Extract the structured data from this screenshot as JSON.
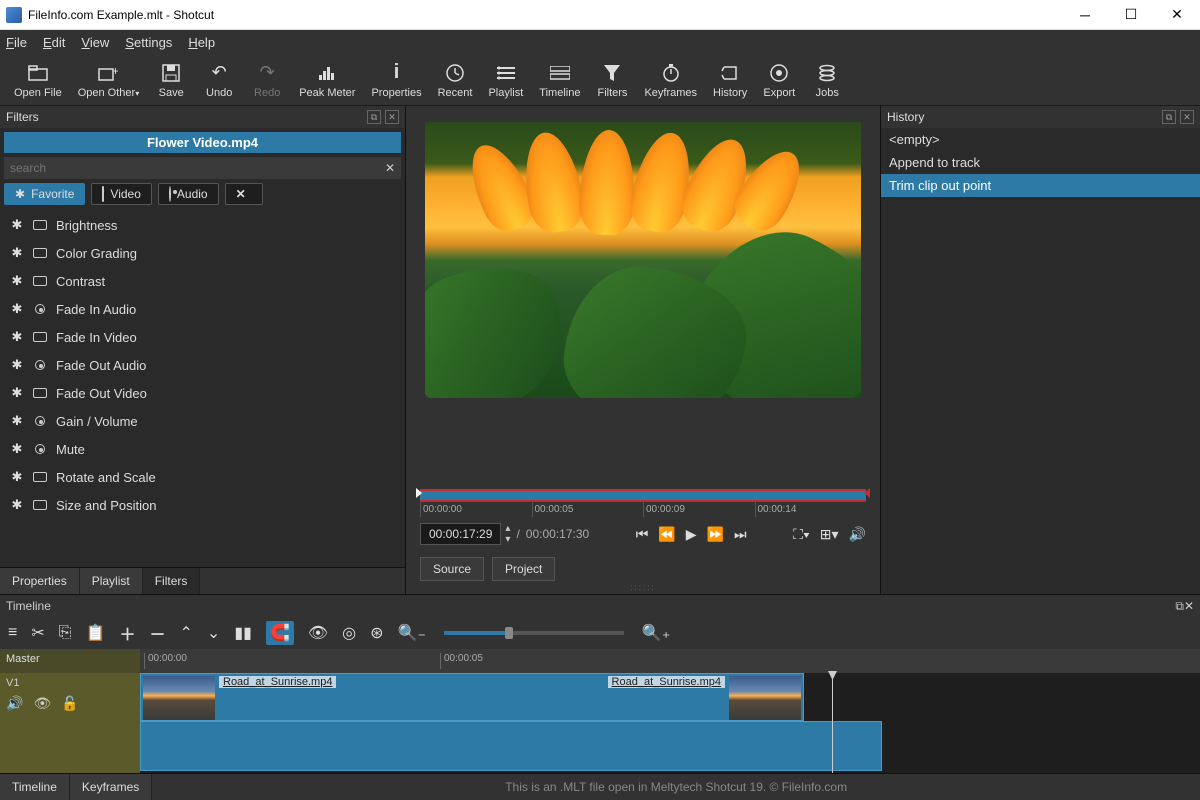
{
  "window": {
    "title": "FileInfo.com Example.mlt - Shotcut"
  },
  "menubar": [
    "File",
    "Edit",
    "View",
    "Settings",
    "Help"
  ],
  "toolbar": [
    {
      "label": "Open File",
      "icon": "folder"
    },
    {
      "label": "Open Other",
      "icon": "folder-plus",
      "dropdown": true
    },
    {
      "label": "Save",
      "icon": "save"
    },
    {
      "label": "Undo",
      "icon": "undo"
    },
    {
      "label": "Redo",
      "icon": "redo",
      "dim": true
    },
    {
      "label": "Peak Meter",
      "icon": "meter"
    },
    {
      "label": "Properties",
      "icon": "info"
    },
    {
      "label": "Recent",
      "icon": "clock"
    },
    {
      "label": "Playlist",
      "icon": "list"
    },
    {
      "label": "Timeline",
      "icon": "timeline"
    },
    {
      "label": "Filters",
      "icon": "funnel"
    },
    {
      "label": "Keyframes",
      "icon": "stopwatch"
    },
    {
      "label": "History",
      "icon": "history"
    },
    {
      "label": "Export",
      "icon": "disc"
    },
    {
      "label": "Jobs",
      "icon": "stack"
    }
  ],
  "filters": {
    "panel_title": "Filters",
    "clip_title": "Flower Video.mp4",
    "search_placeholder": "search",
    "tabs": [
      {
        "icon": "star",
        "label": "Favorite",
        "sel": true
      },
      {
        "icon": "screen",
        "label": "Video"
      },
      {
        "icon": "radio",
        "label": "Audio"
      },
      {
        "icon": "close",
        "label": ""
      }
    ],
    "items": [
      {
        "type": "screen",
        "label": "Brightness"
      },
      {
        "type": "screen",
        "label": "Color Grading"
      },
      {
        "type": "screen",
        "label": "Contrast"
      },
      {
        "type": "radio",
        "label": "Fade In Audio"
      },
      {
        "type": "screen",
        "label": "Fade In Video"
      },
      {
        "type": "radio",
        "label": "Fade Out Audio"
      },
      {
        "type": "screen",
        "label": "Fade Out Video"
      },
      {
        "type": "radio",
        "label": "Gain / Volume"
      },
      {
        "type": "radio",
        "label": "Mute"
      },
      {
        "type": "screen",
        "label": "Rotate and Scale"
      },
      {
        "type": "screen",
        "label": "Size and Position"
      }
    ],
    "bottom_tabs": [
      "Properties",
      "Playlist",
      "Filters"
    ],
    "active_bottom": 2
  },
  "preview": {
    "ticks": [
      "00:00:00",
      "00:00:05",
      "00:00:09",
      "00:00:14"
    ],
    "timecode": "00:00:17:29",
    "duration": "00:00:17:30",
    "tabs": [
      "Source",
      "Project"
    ]
  },
  "history": {
    "panel_title": "History",
    "items": [
      "<empty>",
      "Append to track",
      "Trim clip out point"
    ],
    "selected": 2
  },
  "timeline": {
    "panel_title": "Timeline",
    "master": "Master",
    "track": "V1",
    "ruler": [
      "00:00:00",
      "00:00:05"
    ],
    "clip1_label": "Road_at_Sunrise.mp4",
    "clip2_label": "Road_at_Sunrise.mp4",
    "bottom_tabs": [
      "Timeline",
      "Keyframes"
    ]
  },
  "status": "This is an .MLT file open in Meltytech Shotcut 19. © FileInfo.com"
}
